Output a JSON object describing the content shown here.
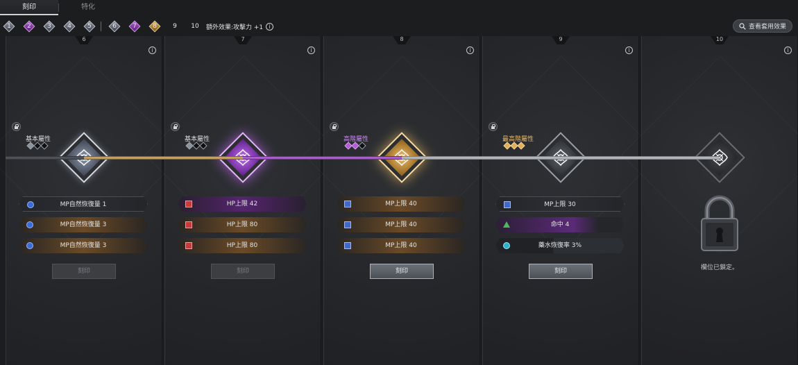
{
  "tabs": [
    {
      "label": "刻印",
      "active": true
    },
    {
      "label": "特化",
      "active": false
    }
  ],
  "levels": [
    {
      "label": "1",
      "style": "silver"
    },
    {
      "label": "2",
      "style": "purple"
    },
    {
      "label": "3",
      "style": "silver"
    },
    {
      "label": "4",
      "style": "silver"
    },
    {
      "label": "5",
      "style": "silver"
    },
    {
      "label": "6",
      "style": "silver"
    },
    {
      "label": "7",
      "style": "purple"
    },
    {
      "label": "8",
      "style": "gold"
    },
    {
      "label": "9",
      "style": "empty"
    },
    {
      "label": "10",
      "style": "empty"
    }
  ],
  "bonus_label": "額外效果:攻擊力 +1",
  "view_effects_label": "查看套用效果",
  "panels": [
    {
      "slot": "6",
      "tier_label": "基本屬性",
      "tier_style": "silver",
      "gems": [
        "silver",
        "empty",
        "empty"
      ],
      "emblem_style": "silver",
      "stats": [
        {
          "label": "MP自然恢復量 1",
          "style": "dark",
          "icon": "blue-circle"
        },
        {
          "label": "MP自然恢復量 3",
          "style": "orange",
          "icon": "blue-circle"
        },
        {
          "label": "MP自然恢復量 3",
          "style": "orange",
          "icon": "blue-circle"
        }
      ],
      "button_label": "刻印",
      "button_enabled": false
    },
    {
      "slot": "7",
      "tier_label": "基本屬性",
      "tier_style": "silver",
      "gems": [
        "silver",
        "empty",
        "empty"
      ],
      "emblem_style": "purple",
      "stats": [
        {
          "label": "HP上限 42",
          "style": "purple",
          "icon": "red-square"
        },
        {
          "label": "HP上限 80",
          "style": "orange",
          "icon": "red-square"
        },
        {
          "label": "HP上限 80",
          "style": "orange",
          "icon": "red-square"
        }
      ],
      "button_label": "刻印",
      "button_enabled": false
    },
    {
      "slot": "8",
      "tier_label": "高階屬性",
      "tier_style": "purple",
      "gems": [
        "purple",
        "purple",
        "empty"
      ],
      "emblem_style": "gold",
      "stats": [
        {
          "label": "MP上限 40",
          "style": "orange",
          "icon": "blue-square"
        },
        {
          "label": "MP上限 40",
          "style": "orange",
          "icon": "blue-square"
        },
        {
          "label": "MP上限 40",
          "style": "orange",
          "icon": "blue-square"
        }
      ],
      "button_label": "刻印",
      "button_enabled": true
    },
    {
      "slot": "9",
      "tier_label": "最高階屬性",
      "tier_style": "gold",
      "gems": [
        "gold",
        "gold",
        "gold"
      ],
      "emblem_style": "gray",
      "stats": [
        {
          "label": "MP上限 30",
          "style": "dark",
          "icon": "blue-square"
        },
        {
          "label": "命中 4",
          "style": "purple-part",
          "icon": "green-tri"
        },
        {
          "label": "藥水恢復率 3%",
          "style": "partial",
          "icon": "cyan-circle"
        }
      ],
      "button_label": "刻印",
      "button_enabled": true
    },
    {
      "slot": "10",
      "emblem_style": "locked",
      "locked_text": "欄位已鎖定。"
    }
  ],
  "info_glyph": "i",
  "colors": {
    "background": "#1c1d1f",
    "purple": "#b35bd9",
    "gold": "#e1af55",
    "silver": "#c9ccd1"
  }
}
